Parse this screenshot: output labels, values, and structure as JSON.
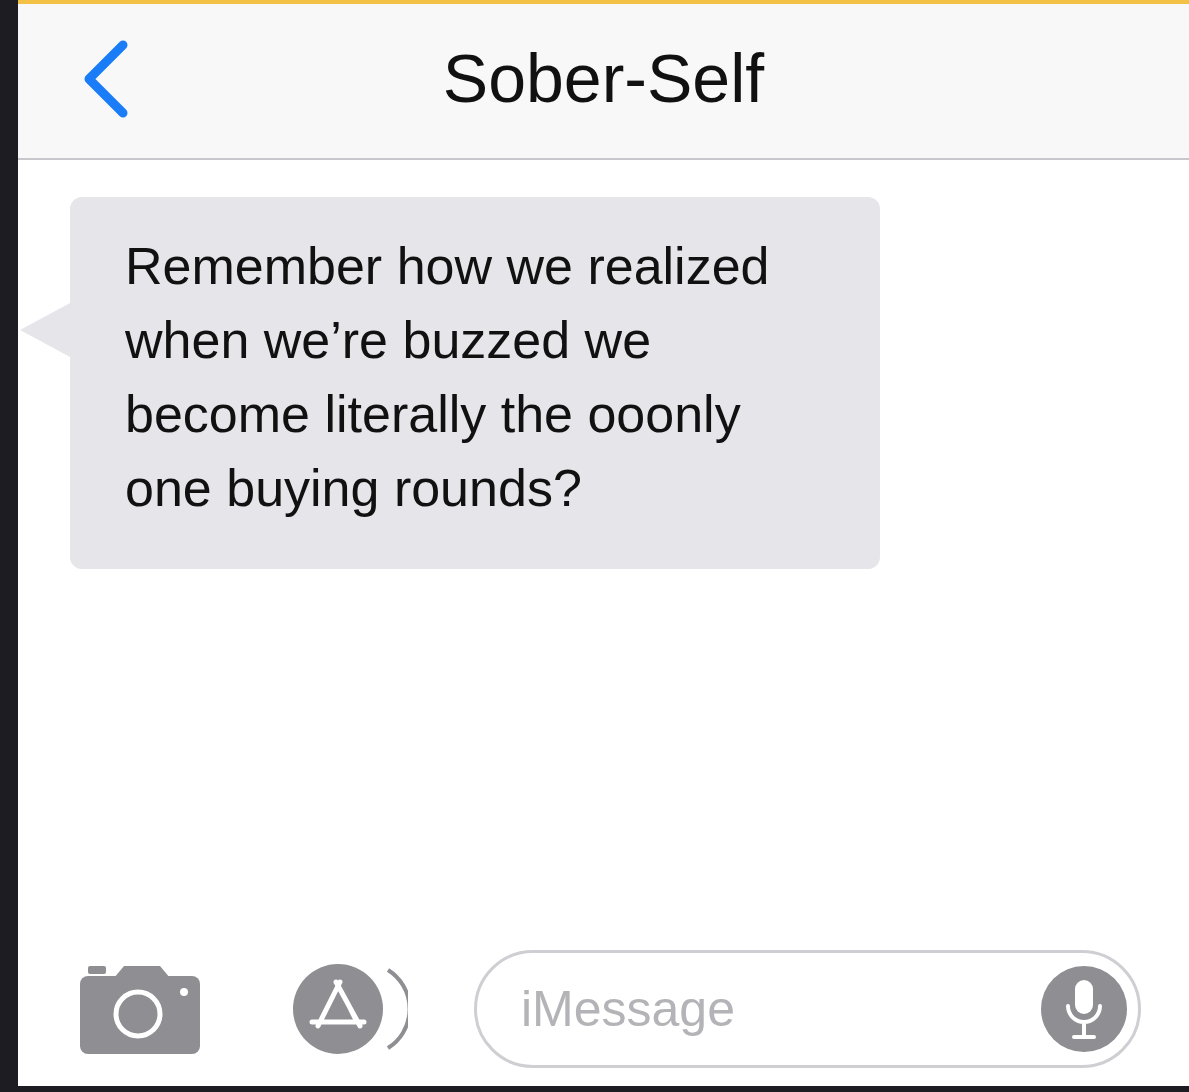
{
  "header": {
    "title": "Sober-Self"
  },
  "messages": [
    {
      "kind": "incoming",
      "text": "Remember how we realized when we’re buzzed we become literally the ooonly one buying rounds?"
    }
  ],
  "input": {
    "placeholder": "iMessage"
  }
}
